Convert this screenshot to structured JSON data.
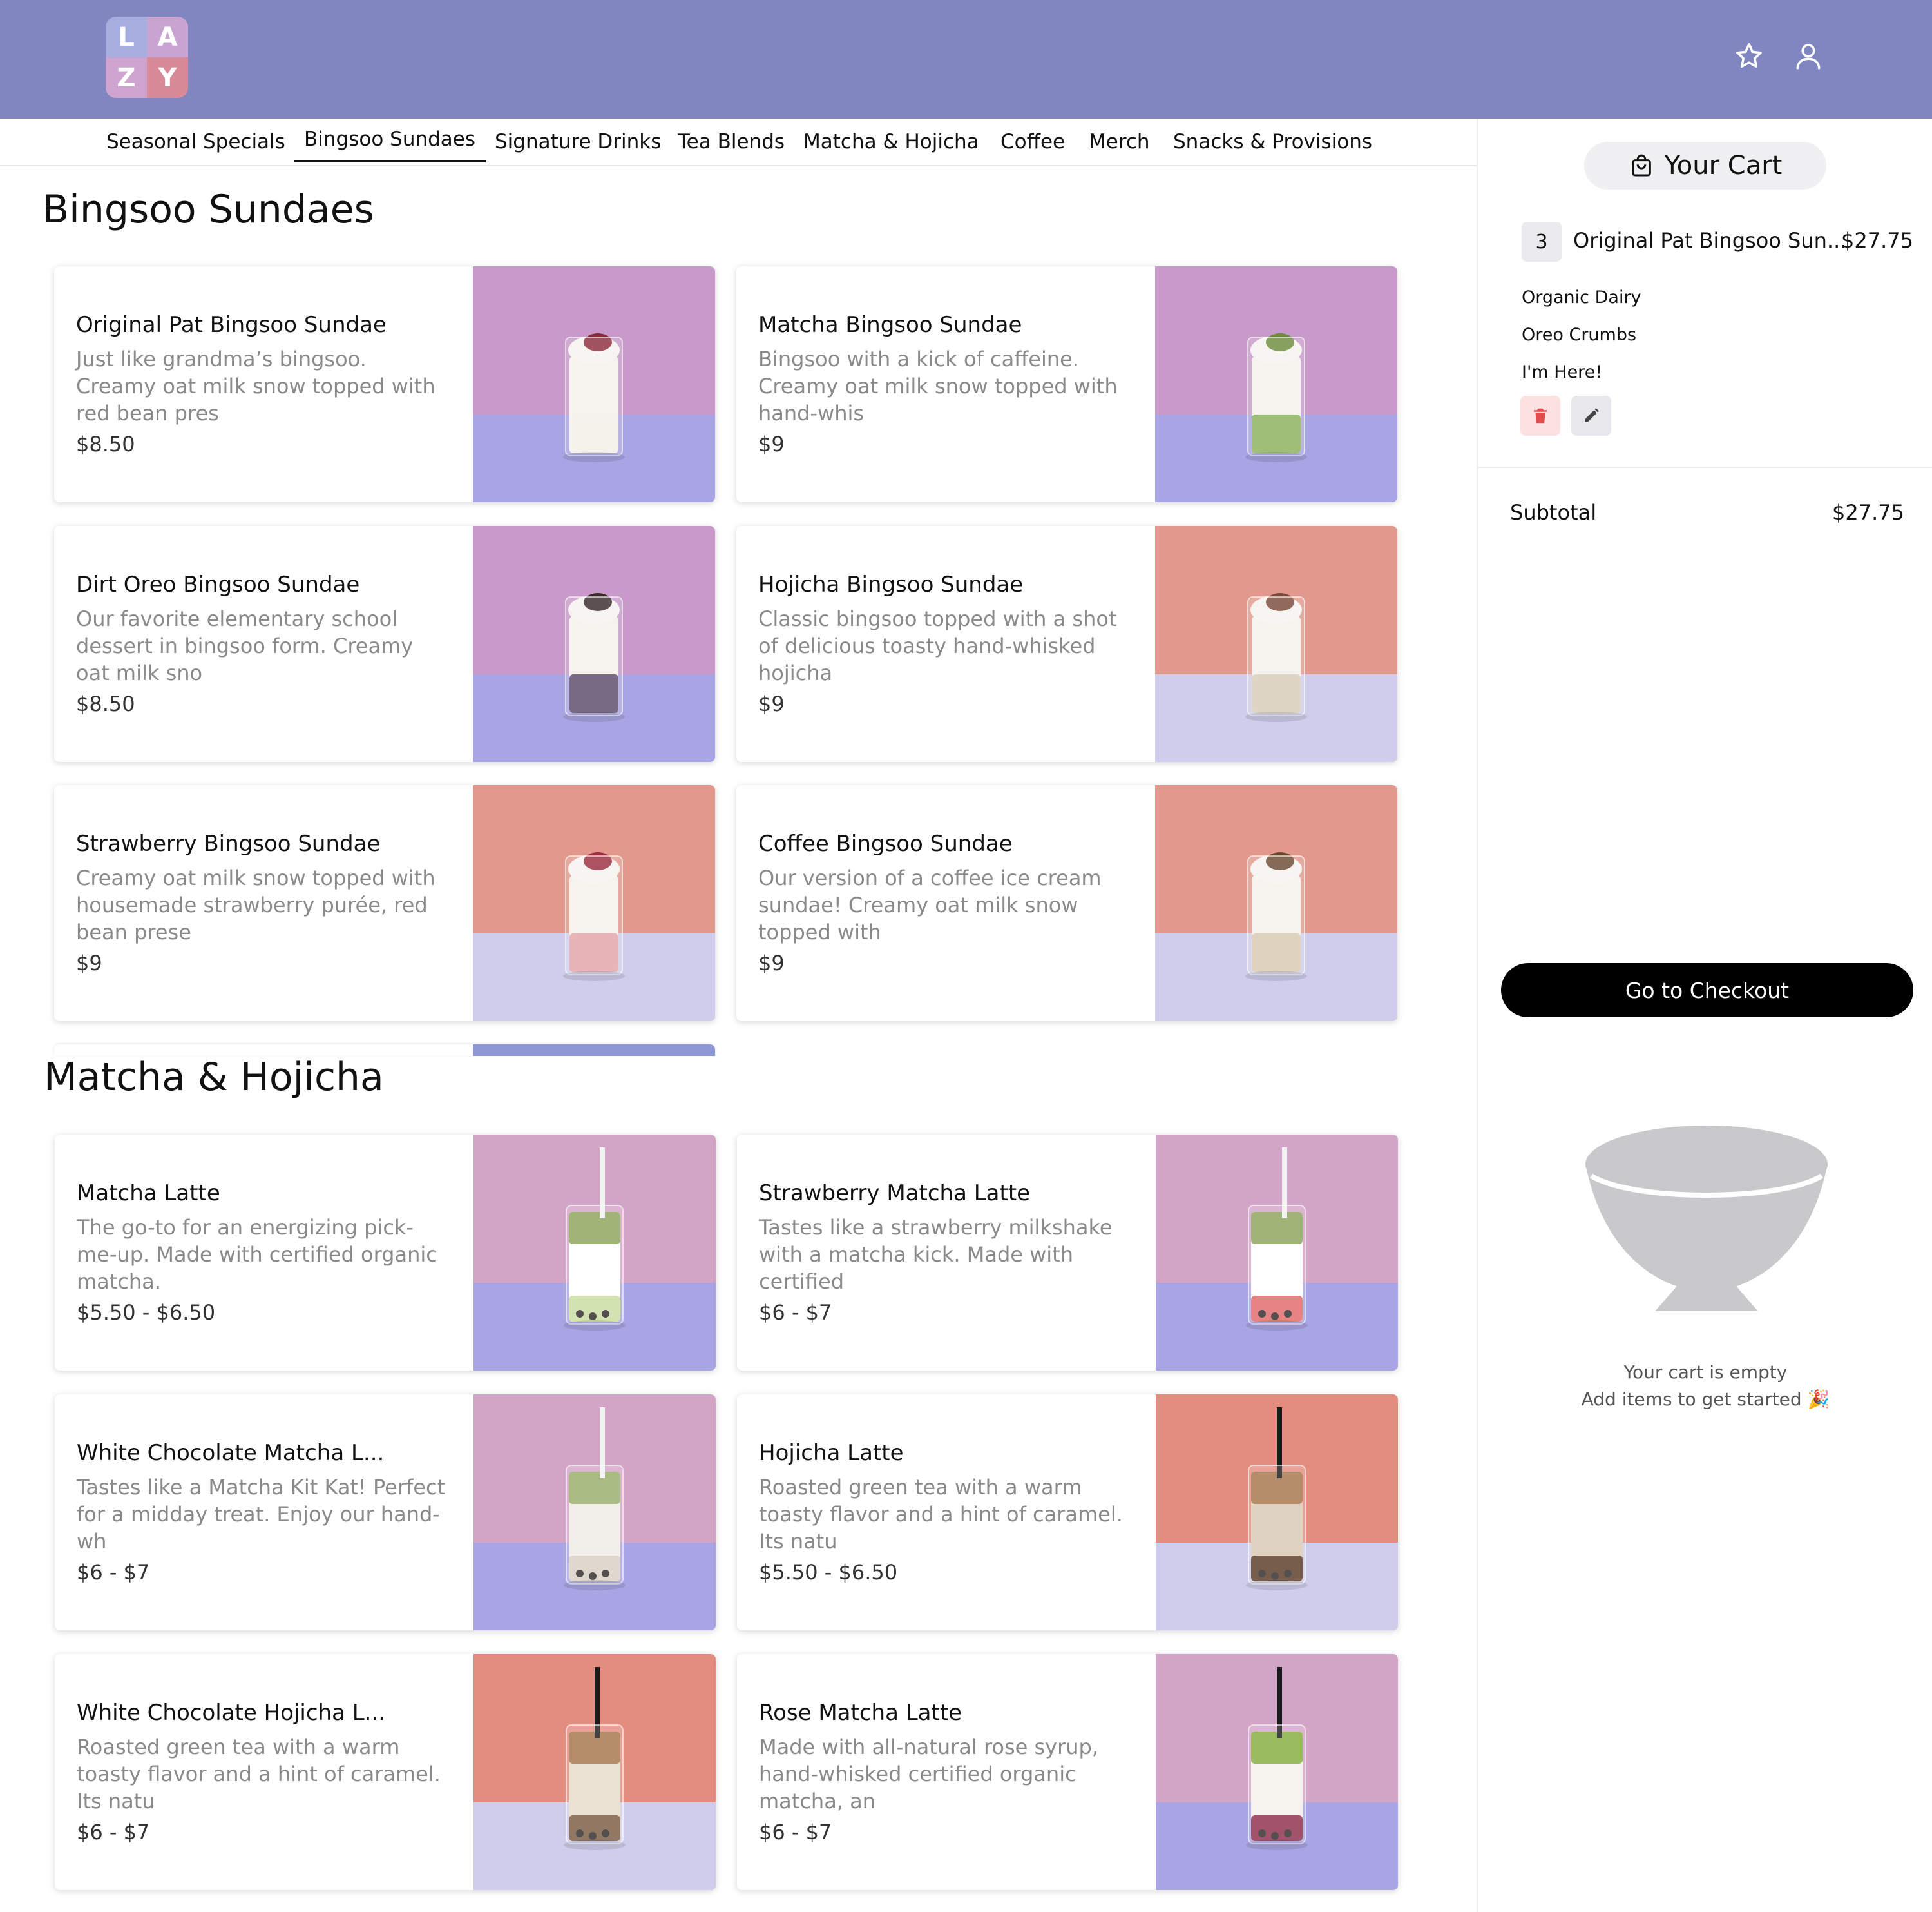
{
  "header": {
    "logo_letters": [
      "L",
      "A",
      "Z",
      "Y"
    ],
    "icons": {
      "favorites": "star-icon",
      "account": "user-icon"
    },
    "brand_color": "#8086bf"
  },
  "nav": {
    "tabs": [
      {
        "label": "Seasonal Specials",
        "active": false
      },
      {
        "label": "Bingsoo Sundaes",
        "active": true
      },
      {
        "label": "Signature Drinks",
        "active": false
      },
      {
        "label": "Tea Blends",
        "active": false
      },
      {
        "label": "Matcha & Hojicha",
        "active": false
      },
      {
        "label": "Coffee",
        "active": false
      },
      {
        "label": "Merch",
        "active": false
      },
      {
        "label": "Snacks & Provisions",
        "active": false
      }
    ]
  },
  "sections": [
    {
      "title": "Bingsoo Sundaes",
      "items": [
        {
          "name": "Original Pat Bingsoo Sundae",
          "desc": "Just like grandma’s bingsoo. Creamy oat milk snow topped with red bean pres",
          "price": "$8.50",
          "photo_bg": "#c79ac9"
        },
        {
          "name": "Matcha Bingsoo Sundae",
          "desc": "Bingsoo with a kick of caffeine. Creamy oat milk snow topped with hand-whis",
          "price": "$9",
          "photo_bg": "#c79ac9"
        },
        {
          "name": "Dirt Oreo Bingsoo Sundae",
          "desc": "Our favorite elementary school dessert in bingsoo form. Creamy oat milk sno",
          "price": "$8.50",
          "photo_bg": "#c79ac9"
        },
        {
          "name": "Hojicha Bingsoo Sundae",
          "desc": "Classic bingsoo topped with a shot of delicious toasty hand-whisked hojicha",
          "price": "$9",
          "photo_bg": "#e0998c"
        },
        {
          "name": "Strawberry Bingsoo Sundae",
          "desc": "Creamy oat milk snow topped with housemade strawberry purée, red bean prese",
          "price": "$9",
          "photo_bg": "#e0998c"
        },
        {
          "name": "Coffee Bingsoo Sundae",
          "desc": "Our version of a coffee ice cream sundae! Creamy oat milk snow topped with",
          "price": "$9",
          "photo_bg": "#e0998c"
        }
      ]
    },
    {
      "title": "Matcha & Hojicha",
      "items": [
        {
          "name": "Matcha Latte",
          "desc": "The go-to for an energizing pick-me-up. Made with certified organic matcha.",
          "price": "$5.50 - $6.50",
          "photo_bg": "#d2a4c6"
        },
        {
          "name": "Strawberry Matcha Latte",
          "desc": "Tastes like a strawberry milkshake with a matcha kick. Made with certified",
          "price": "$6 - $7",
          "photo_bg": "#d2a4c6"
        },
        {
          "name": "White Chocolate Matcha L...",
          "desc": "Tastes like a Matcha Kit Kat! Perfect for a midday treat. Enjoy our hand-wh",
          "price": "$6 - $7",
          "photo_bg": "#d2a4c6"
        },
        {
          "name": "Hojicha Latte",
          "desc": "Roasted green tea with a warm toasty flavor and a hint of caramel. Its natu",
          "price": "$5.50 - $6.50",
          "photo_bg": "#e28d80"
        },
        {
          "name": "White Chocolate Hojicha L...",
          "desc": "Roasted green tea with a warm toasty flavor and a hint of caramel. Its natu",
          "price": "$6 - $7",
          "photo_bg": "#e28d80"
        },
        {
          "name": "Rose Matcha Latte",
          "desc": "Made with all-natural rose syrup, hand-whisked certified organic matcha, an",
          "price": "$6 - $7",
          "photo_bg": "#d2a4c6"
        }
      ]
    }
  ],
  "cart": {
    "title": "Your Cart",
    "icon": "shopping-bag-icon",
    "line_item": {
      "qty": "3",
      "name": "Original Pat Bingsoo Sun...",
      "price": "$27.75",
      "modifiers": [
        "Organic Dairy",
        "Oreo Crumbs",
        "I'm Here!"
      ]
    },
    "subtotal_label": "Subtotal",
    "subtotal_value": "$27.75",
    "checkout_label": "Go to Checkout",
    "empty_line1": "Your cart is empty",
    "empty_line2": "Add items to get started 🎉",
    "delete_color": "#e34c4c"
  }
}
